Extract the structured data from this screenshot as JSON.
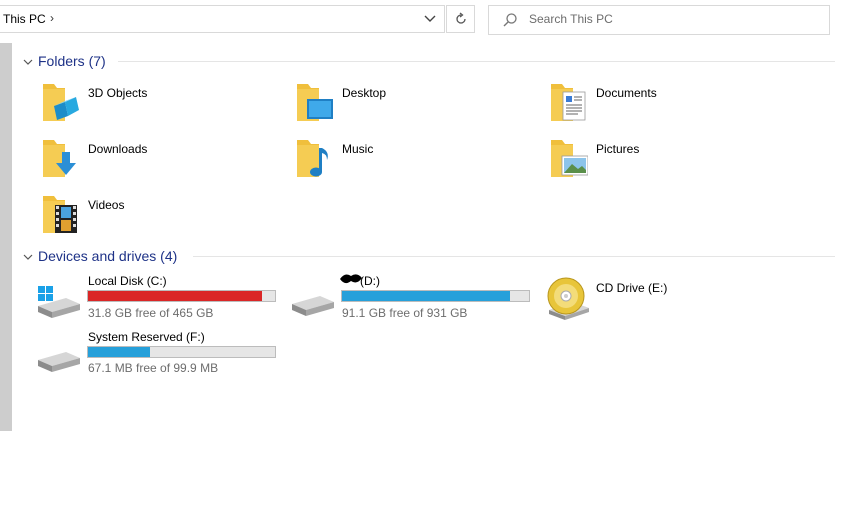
{
  "address": {
    "path": "This PC",
    "separator": "›"
  },
  "refresh_icon": "refresh-icon",
  "search": {
    "placeholder": "Search This PC"
  },
  "groups": {
    "folders": {
      "title": "Folders (7)"
    },
    "drives": {
      "title": "Devices and drives (4)"
    }
  },
  "folders": [
    {
      "label": "3D Objects",
      "icon": "3d-objects-folder-icon"
    },
    {
      "label": "Desktop",
      "icon": "desktop-folder-icon"
    },
    {
      "label": "Documents",
      "icon": "documents-folder-icon"
    },
    {
      "label": "Downloads",
      "icon": "downloads-folder-icon"
    },
    {
      "label": "Music",
      "icon": "music-folder-icon"
    },
    {
      "label": "Pictures",
      "icon": "pictures-folder-icon"
    },
    {
      "label": "Videos",
      "icon": "videos-folder-icon"
    }
  ],
  "drives": [
    {
      "label": "Local Disk (C:)",
      "free": "31.8 GB free of 465 GB",
      "used_fraction": 0.93,
      "bar_color": "#da2626"
    },
    {
      "label": "(D:)",
      "free": "91.1 GB free of 931 GB",
      "used_fraction": 0.9,
      "bar_color": "#26a0da"
    },
    {
      "label": "CD Drive (E:)"
    },
    {
      "label": "System Reserved (F:)",
      "free": "67.1 MB free of 99.9 MB",
      "used_fraction": 0.33,
      "bar_color": "#26a0da"
    }
  ],
  "colors": {
    "accent": "#1e3287",
    "folder": "#f5cc53",
    "bar_warning": "#da2626",
    "bar_normal": "#26a0da"
  }
}
